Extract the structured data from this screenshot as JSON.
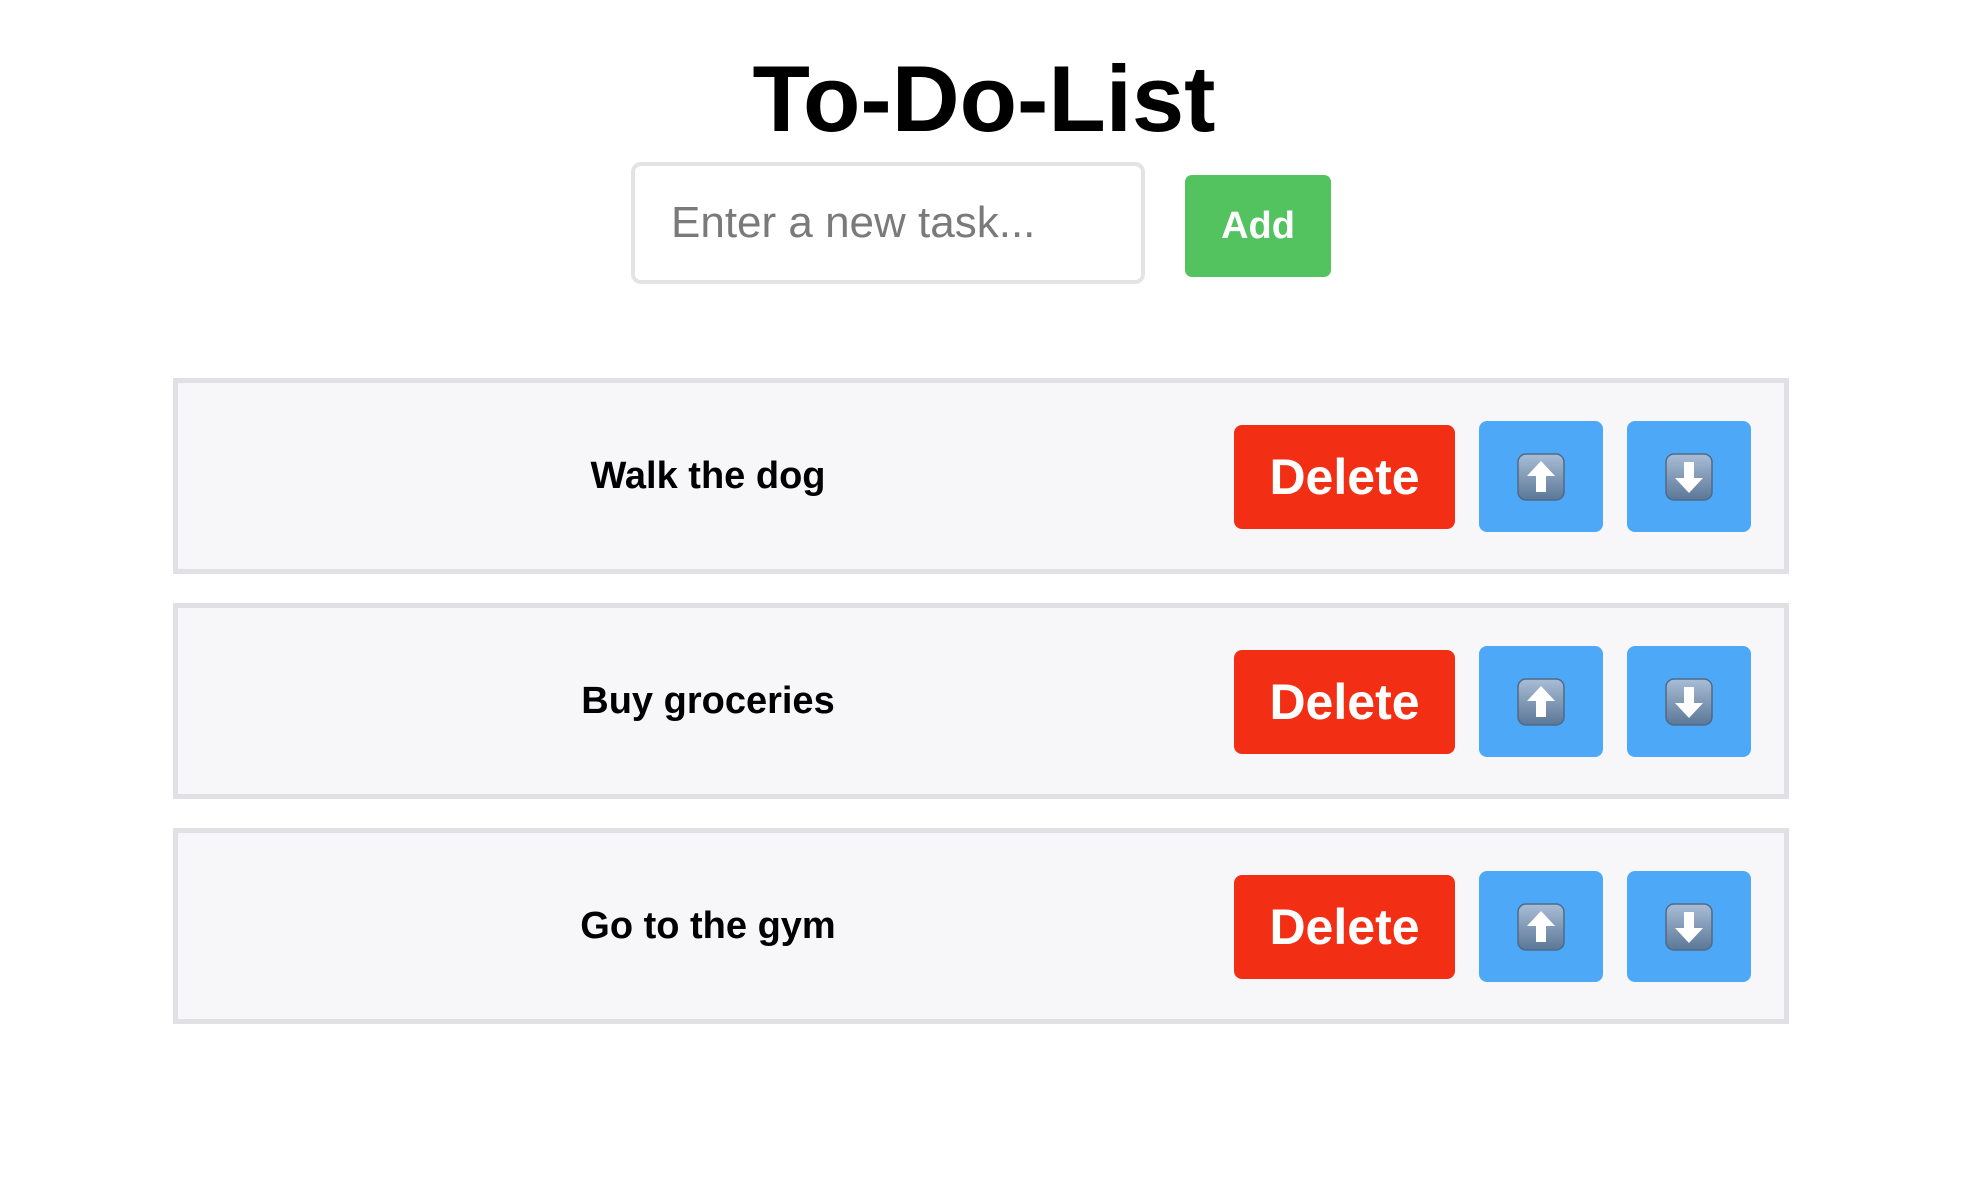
{
  "app": {
    "title": "To-Do-List"
  },
  "new_task": {
    "placeholder": "Enter a new task...",
    "value": "",
    "add_label": "Add"
  },
  "tasks": [
    {
      "text": "Walk the dog",
      "delete_label": "Delete",
      "up_icon": "arrow-up-emoji-icon",
      "down_icon": "arrow-down-emoji-icon"
    },
    {
      "text": "Buy groceries",
      "delete_label": "Delete",
      "up_icon": "arrow-up-emoji-icon",
      "down_icon": "arrow-down-emoji-icon"
    },
    {
      "text": "Go to the gym",
      "delete_label": "Delete",
      "up_icon": "arrow-up-emoji-icon",
      "down_icon": "arrow-down-emoji-icon"
    }
  ],
  "colors": {
    "add_button": "#53c35f",
    "delete_button": "#f22f14",
    "move_button": "#4da9f8",
    "task_background": "#f7f7fa",
    "task_border": "#e0e0e5"
  }
}
